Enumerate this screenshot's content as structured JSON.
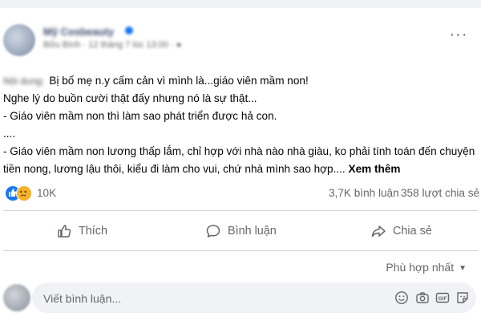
{
  "post": {
    "author_name": "Mỹ Cosbeauty",
    "meta_text": "Bữu Bình · 12 tháng 7 lúc 13:00 · ",
    "content_prefix": "Nội dung:",
    "lines": [
      "Bị bố mẹ n.y cấm cản vì mình là...giáo viên mầm non!",
      "Nghe lý do buồn cười thật đấy nhưng nó là sự thật...",
      "- Giáo viên mầm non thì làm sao phát triển được hả con.",
      "....",
      "- Giáo viên mầm non lương thấp lắm, chỉ hợp với nhà nào nhà giàu, ko phải tính toán đến chuyện",
      "tiền nong, lương lậu thôi, kiểu đi làm cho vui, chứ nhà mình sao hợp...."
    ],
    "see_more": "Xem thêm"
  },
  "stats": {
    "reactions": "10K",
    "comments": "3,7K bình luận",
    "shares": "358 lượt chia sẻ"
  },
  "actions": {
    "like": "Thích",
    "comment": "Bình luận",
    "share": "Chia sẻ"
  },
  "sort": {
    "label": "Phù hợp nhất"
  },
  "comment_box": {
    "placeholder": "Viết bình luận..."
  },
  "icons": {
    "more": "more-horizontal-icon",
    "like_reaction": "like-reaction-icon",
    "sad_reaction": "sad-reaction-icon",
    "like": "thumbs-up-icon",
    "comment": "comment-bubble-icon",
    "share": "share-arrow-icon",
    "emoji": "emoji-icon",
    "camera": "camera-icon",
    "gif": "gif-icon",
    "sticker": "sticker-icon"
  },
  "colors": {
    "brand": "#1877f2",
    "muted_text": "#65676b",
    "background": "#f0f2f5",
    "sad_reaction": "#f7b125"
  }
}
